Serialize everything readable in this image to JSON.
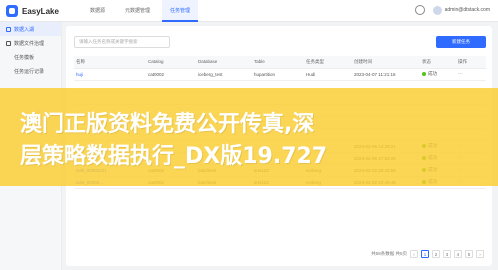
{
  "header": {
    "logo_text": "EasyLake",
    "nav": [
      {
        "label": "数据源"
      },
      {
        "label": "元数据管理"
      },
      {
        "label": "任务管理"
      }
    ],
    "user": "admin@dtstack.com"
  },
  "sidebar": {
    "items": [
      {
        "label": "数据入湖"
      },
      {
        "label": "数据文件治理"
      },
      {
        "label": "任务模板"
      },
      {
        "label": "任务运行记录"
      }
    ]
  },
  "toolbar": {
    "search_placeholder": "请输入任务名称或关键字搜索",
    "create_label": "新建任务"
  },
  "table": {
    "columns": [
      "名称",
      "Catalog",
      "Database",
      "Table",
      "任务类型",
      "创建时间",
      "状态",
      "操作"
    ],
    "rows": [
      {
        "name": "huji",
        "catalog": "cat0002",
        "database": "iceberg_test",
        "table": "hupartition",
        "type": "Hudi",
        "created": "2023-04-07 11:21:16",
        "status": "成功",
        "action": "⋯"
      },
      {
        "name": "",
        "catalog": "",
        "database": "",
        "table": "",
        "type": "",
        "created": "",
        "status": "",
        "action": ""
      },
      {
        "name": "",
        "catalog": "",
        "database": "",
        "table": "",
        "type": "",
        "created": "",
        "status": "",
        "action": ""
      },
      {
        "name": "",
        "catalog": "",
        "database": "",
        "table": "",
        "type": "",
        "created": "",
        "status": "",
        "action": ""
      },
      {
        "name": "",
        "catalog": "",
        "database": "",
        "table": "",
        "type": "",
        "created": "",
        "status": "",
        "action": ""
      },
      {
        "name": "",
        "catalog": "",
        "database": "",
        "table": "",
        "type": "",
        "created": "",
        "status": "",
        "action": ""
      },
      {
        "name": "",
        "catalog": "",
        "database": "",
        "table": "",
        "type": "",
        "created": "2023-02-06 14:29:21",
        "status": "成功",
        "action": "⋯"
      },
      {
        "name": "",
        "catalog": "",
        "database": "",
        "table": "",
        "type": "",
        "created": "2023-02-06 17:52:05",
        "status": "成功",
        "action": "⋯"
      },
      {
        "name": "task_00002341",
        "catalog": "cat0002",
        "database": "batchtest",
        "table": "test123",
        "type": "Iceberg",
        "created": "2023-02-02 20:43:58",
        "status": "成功",
        "action": "⋯"
      },
      {
        "name": "task_00002...",
        "catalog": "cat0002",
        "database": "batchtest",
        "table": "test123",
        "type": "Iceberg",
        "created": "2023-02-02 20:49:48",
        "status": "成功",
        "action": "⋯"
      }
    ]
  },
  "pager": {
    "total_text": "共58条数据 共5页",
    "pages": [
      "1",
      "2",
      "3",
      "4",
      "5"
    ],
    "current": "1"
  },
  "banner": {
    "line1": "澳门正版资料免费公开传真,深",
    "line2": "层策略数据执行_DX版19.727"
  },
  "colors": {
    "accent": "#2f6bff",
    "success": "#52c41a",
    "banner": "#facc2e"
  }
}
